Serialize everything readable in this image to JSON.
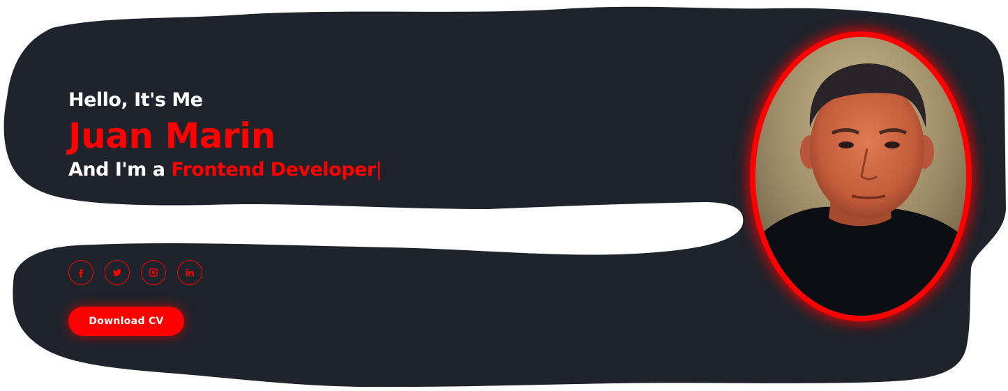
{
  "hero": {
    "greeting": "Hello, It's Me",
    "name": "Juan Marin",
    "role_prefix": "And I'm a",
    "role": "Frontend Developer",
    "cursor": "|"
  },
  "socials": [
    {
      "icon": "facebook-icon",
      "glyph": "f"
    },
    {
      "icon": "twitter-icon"
    },
    {
      "icon": "instagram-icon"
    },
    {
      "icon": "linkedin-icon",
      "glyph": "in"
    }
  ],
  "cta": {
    "label": "Download CV"
  },
  "colors": {
    "accent": "#ff0000",
    "background": "#1f232b",
    "text": "#ffffff"
  }
}
